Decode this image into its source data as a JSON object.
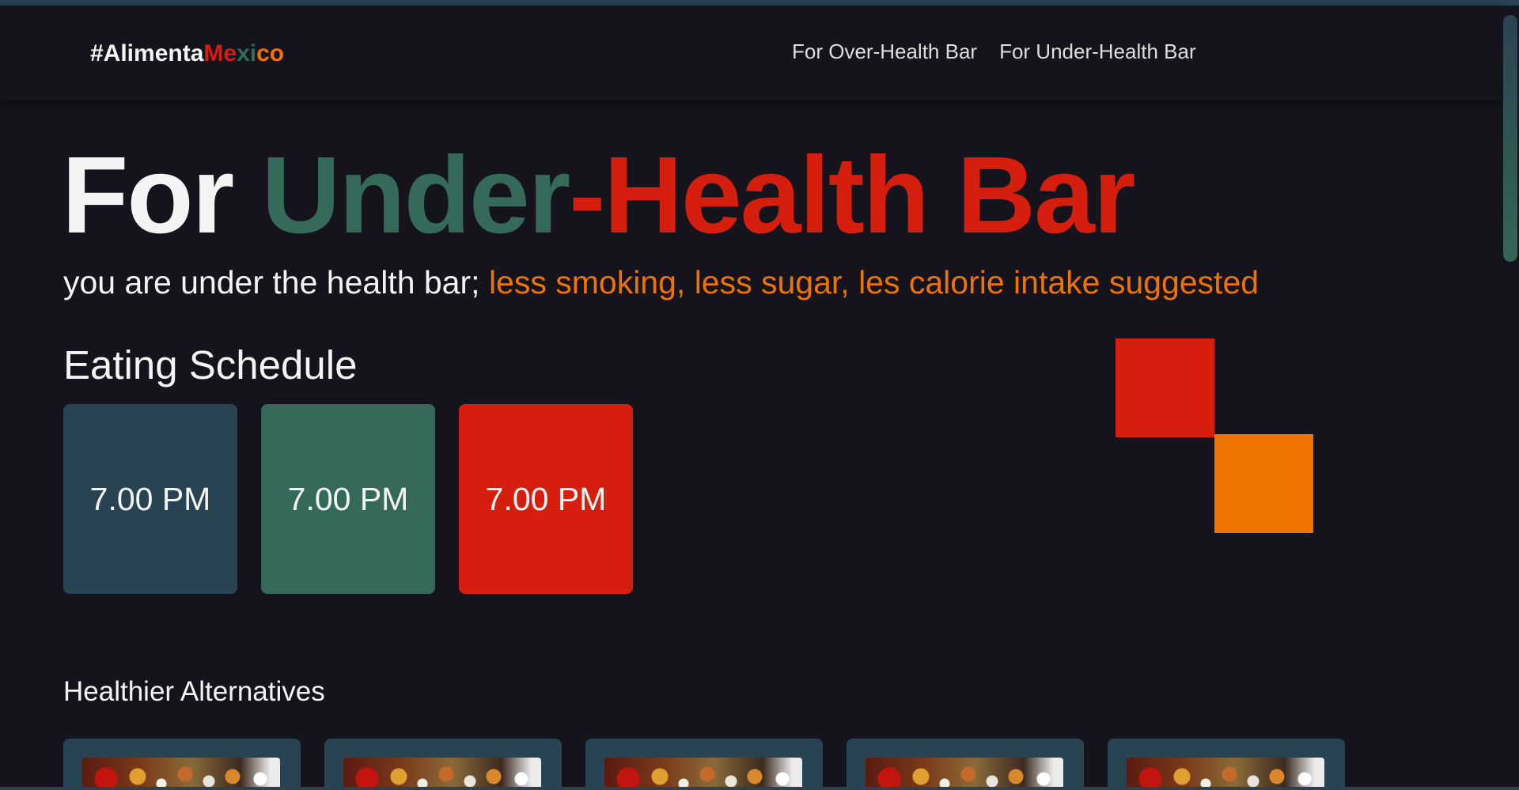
{
  "brand": {
    "logo_part_1": "#Alimenta",
    "logo_part_2": "Me",
    "logo_part_3": "xi",
    "logo_part_4": "co"
  },
  "nav": {
    "items": [
      {
        "label": "For Over-Health Bar"
      },
      {
        "label": "For Under-Health Bar"
      }
    ]
  },
  "hero": {
    "title_part_1": "For ",
    "title_part_2": "Under",
    "title_part_3": "-Health Bar",
    "subtitle_part_1": "you are under the health bar; ",
    "subtitle_part_2": "less smoking, less sugar, les calorie intake suggested"
  },
  "schedule": {
    "heading": "Eating Schedule",
    "times": [
      "7.00 PM",
      "7.00 PM",
      "7.00 PM"
    ]
  },
  "alternatives": {
    "heading": "Healthier Alternatives",
    "cards": [
      "food-image",
      "food-image",
      "food-image",
      "food-image",
      "food-image"
    ]
  },
  "colors": {
    "background": "#15141d",
    "navy": "#284453",
    "green": "#356a5b",
    "red": "#d51e0e",
    "orange": "#ee7300",
    "white": "#f4f4f4"
  }
}
